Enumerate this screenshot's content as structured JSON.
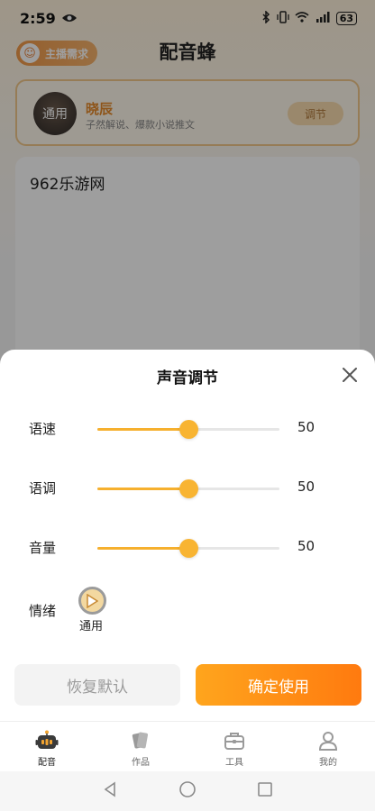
{
  "status_bar": {
    "time": "2:59",
    "battery": "63"
  },
  "header": {
    "title": "配音蜂",
    "badge_label": "主播需求"
  },
  "voice_card": {
    "avatar_text": "通用",
    "name": "晓辰",
    "description": "子然解说、爆款小说推文",
    "adjust_label": "调节"
  },
  "editor": {
    "text": "962乐游网"
  },
  "sheet": {
    "title": "声音调节",
    "sliders": [
      {
        "label": "语速",
        "value": "50",
        "fraction": 0.5
      },
      {
        "label": "语调",
        "value": "50",
        "fraction": 0.5
      },
      {
        "label": "音量",
        "value": "50",
        "fraction": 0.5
      }
    ],
    "emotion_label": "情绪",
    "emotion_option": "通用",
    "reset_label": "恢复默认",
    "confirm_label": "确定使用"
  },
  "tabs": [
    {
      "label": "配音",
      "icon": "robot-icon"
    },
    {
      "label": "作品",
      "icon": "works-icon"
    },
    {
      "label": "工具",
      "icon": "toolbox-icon"
    },
    {
      "label": "我的",
      "icon": "profile-icon"
    }
  ],
  "colors": {
    "accent": "#ff8c16",
    "slider": "#f6b02e"
  }
}
